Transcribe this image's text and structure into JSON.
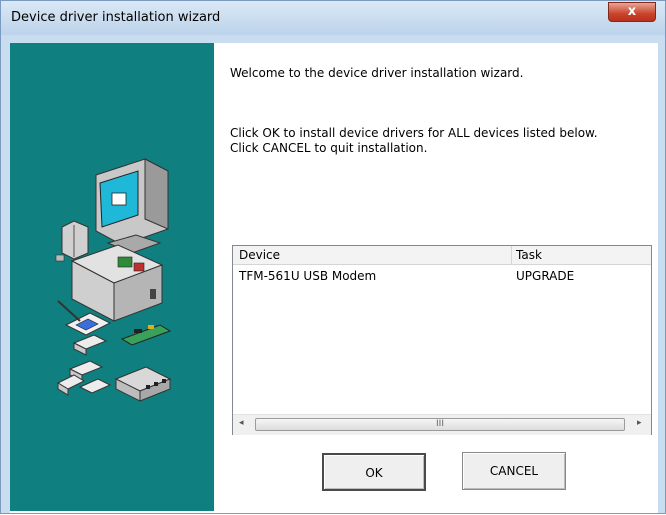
{
  "window": {
    "title": "Device driver installation wizard",
    "close_label": "x"
  },
  "content": {
    "welcome": "Welcome to the device driver installation wizard.",
    "instructions": "Click OK to install device drivers for ALL devices listed below. Click CANCEL to quit installation."
  },
  "device_list": {
    "columns": [
      "Device",
      "Task"
    ],
    "rows": [
      {
        "device": "TFM-561U USB Modem",
        "task": "UPGRADE"
      }
    ],
    "scroll_grip": "III",
    "scroll_left": "◂",
    "scroll_right": "▸"
  },
  "buttons": {
    "ok": "OK",
    "cancel": "CANCEL"
  },
  "colors": {
    "side_panel": "#107f7f",
    "close_button": "#c9442c"
  },
  "icons": [
    "computer-hardware-illustration"
  ]
}
